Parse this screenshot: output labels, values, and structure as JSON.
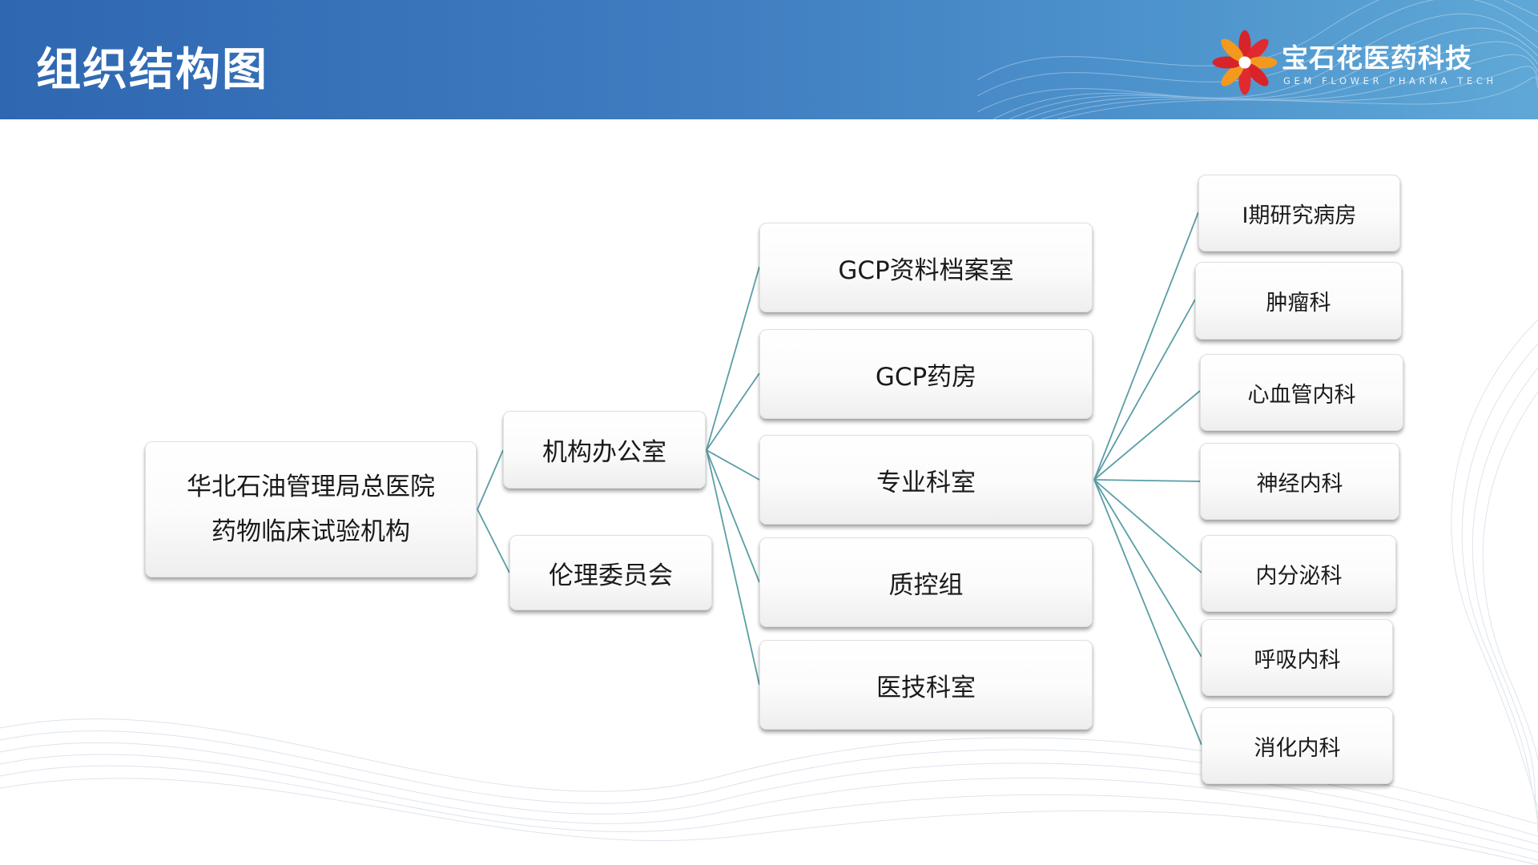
{
  "header": {
    "title": "组织结构图",
    "logo": {
      "name": "宝石花医药科技",
      "tagline": "GEM FLOWER PHARMA TECH"
    }
  },
  "colors": {
    "header_blue": "#2f67b1",
    "connector": "#5a9ea6",
    "logo_red": "#d8232a",
    "logo_orange": "#f39a1e"
  },
  "org": {
    "root": {
      "line1": "华北石油管理局总医院",
      "line2": "药物临床试验机构"
    },
    "level1": [
      {
        "label": "机构办公室"
      },
      {
        "label": "伦理委员会"
      }
    ],
    "level2": [
      {
        "label": "GCP资料档案室"
      },
      {
        "label": "GCP药房"
      },
      {
        "label": "专业科室"
      },
      {
        "label": "质控组"
      },
      {
        "label": "医技科室"
      }
    ],
    "departments": [
      {
        "label": "I期研究病房"
      },
      {
        "label": "肿瘤科"
      },
      {
        "label": "心血管内科"
      },
      {
        "label": "神经内科"
      },
      {
        "label": "内分泌科"
      },
      {
        "label": "呼吸内科"
      },
      {
        "label": "消化内科"
      }
    ]
  }
}
